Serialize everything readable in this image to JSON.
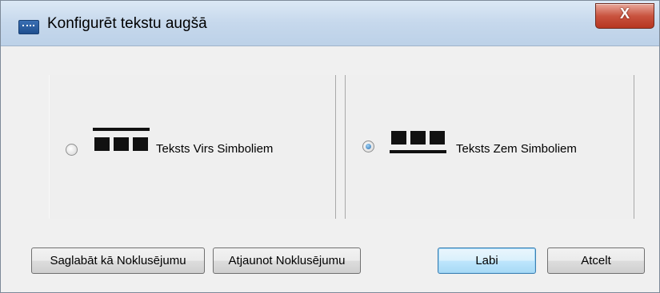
{
  "window": {
    "title": "Konfigurēt tekstu augšā",
    "close_glyph": "X",
    "app_icon": "dialog-app-icon"
  },
  "options": [
    {
      "label": "Teksts Virs Simboliem",
      "selected": false,
      "icon": "text-above-symbols-icon"
    },
    {
      "label": "Teksts Zem Simboliem",
      "selected": true,
      "icon": "text-below-symbols-icon"
    }
  ],
  "buttons": {
    "save_default": "Saglabāt kā Noklusējumu",
    "restore_default": "Atjaunot Noklusējumu",
    "ok": "Labi",
    "cancel": "Atcelt"
  },
  "colors": {
    "titlebar": "#c6d8ec",
    "close_button": "#c9533f",
    "default_button": "#bee6fd"
  }
}
